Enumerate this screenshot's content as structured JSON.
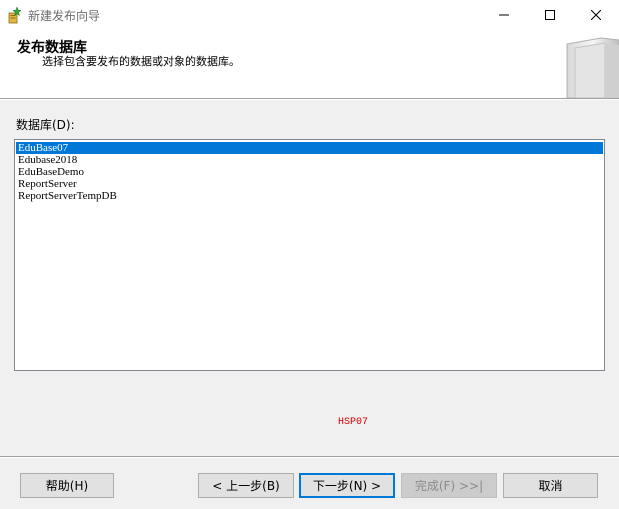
{
  "window": {
    "title": "新建发布向导",
    "controls": {
      "minimize_icon": "minimize-icon",
      "maximize_icon": "maximize-icon",
      "close_icon": "close-icon"
    }
  },
  "header": {
    "title": "发布数据库",
    "subtitle": "选择包含要发布的数据或对象的数据库。",
    "art_icon": "database-art-icon"
  },
  "database_list": {
    "label": "数据库(D):",
    "items": [
      {
        "name": "EduBase07",
        "selected": true
      },
      {
        "name": "Edubase2018",
        "selected": false
      },
      {
        "name": "EduBaseDemo",
        "selected": false
      },
      {
        "name": "ReportServer",
        "selected": false
      },
      {
        "name": "ReportServerTempDB",
        "selected": false
      }
    ]
  },
  "server_name": "HSP07",
  "buttons": {
    "help": "帮助(H)",
    "prev": "< 上一步(B)",
    "next": "下一步(N) >",
    "finish": "完成(F) >>|",
    "cancel": "取消"
  },
  "colors": {
    "selection": "#0078d7",
    "server_name": "#cc0000",
    "dialog_bg": "#f0f0f0"
  }
}
